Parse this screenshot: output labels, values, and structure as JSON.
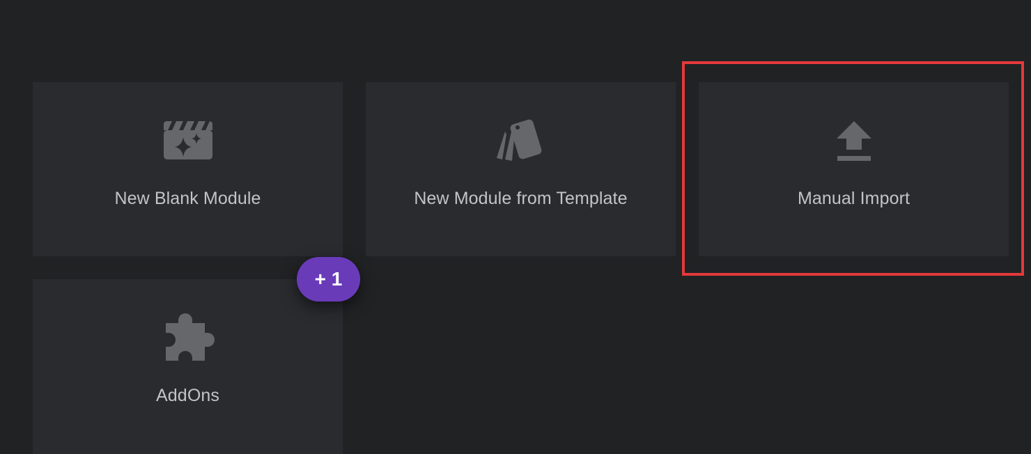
{
  "colors": {
    "background": "#212224",
    "card": "#2a2b2f",
    "icon": "#66676b",
    "label": "#c2c4c8",
    "highlight": "#e5393b",
    "badge": "#6a3bb9"
  },
  "cards": [
    {
      "label": "New Blank Module",
      "icon": "clapperboard-sparkle-icon"
    },
    {
      "label": "New Module from Template",
      "icon": "template-cards-icon"
    },
    {
      "label": "Manual Import",
      "icon": "upload-icon"
    },
    {
      "label": "AddOns",
      "icon": "puzzle-piece-icon"
    }
  ],
  "badge": {
    "label": "+ 1"
  }
}
